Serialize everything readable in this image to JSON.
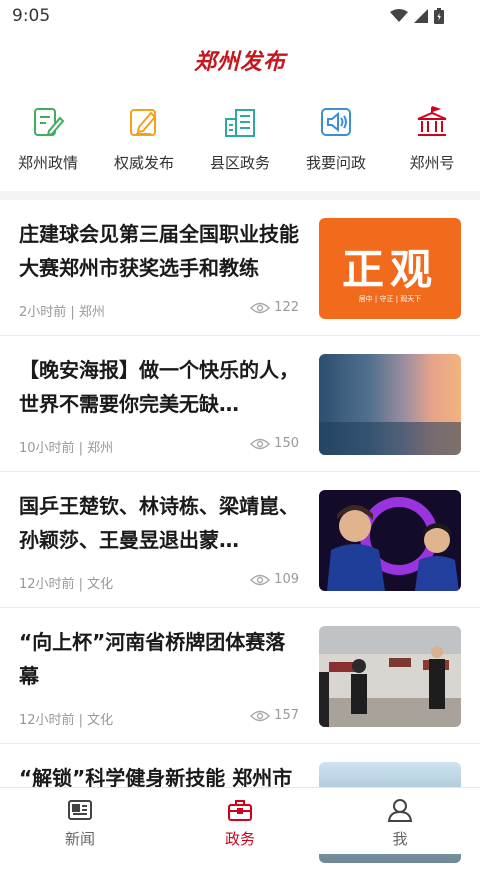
{
  "status_bar": {
    "time": "9:05"
  },
  "header": {
    "logo_text": "郑州发布"
  },
  "quick_nav": [
    {
      "label": "郑州政情",
      "icon": "pen-note-icon",
      "color": "#3fae5f"
    },
    {
      "label": "权威发布",
      "icon": "edit-doc-icon",
      "color": "#f3a21b"
    },
    {
      "label": "县区政务",
      "icon": "buildings-icon",
      "color": "#2fa8a0"
    },
    {
      "label": "我要问政",
      "icon": "speaker-icon",
      "color": "#3a8fd8"
    },
    {
      "label": "郑州号",
      "icon": "hall-icon",
      "color": "#d0021b"
    }
  ],
  "news": [
    {
      "title": "庄建球会见第三届全国职业技能大赛郑州市获奖选手和教练",
      "meta": "2小时前 | 郑州",
      "views": "122",
      "thumb": {
        "type": "banner",
        "text": "正观",
        "sub": "居中 | 守正 | 观天下"
      }
    },
    {
      "title": "【晚安海报】做一个快乐的人，世界不需要你完美无缺…",
      "meta": "10小时前 | 郑州",
      "views": "150",
      "thumb": {
        "type": "sunset"
      }
    },
    {
      "title": "国乒王楚钦、林诗栋、梁靖崑、孙颖莎、王曼昱退出蒙…",
      "meta": "12小时前 | 文化",
      "views": "109",
      "thumb": {
        "type": "pingpong"
      }
    },
    {
      "title": "“向上杯”河南省桥牌团体赛落幕",
      "meta": "12小时前 | 文化",
      "views": "157",
      "thumb": {
        "type": "hall"
      }
    },
    {
      "title": "“解锁”科学健身新技能 郑州市",
      "meta": "",
      "views": "",
      "thumb": {
        "type": "outdoor"
      }
    }
  ],
  "tabs": [
    {
      "label": "新闻",
      "icon": "newspaper-icon",
      "active": false
    },
    {
      "label": "政务",
      "icon": "briefcase-icon",
      "active": true
    },
    {
      "label": "我",
      "icon": "user-icon",
      "active": false
    }
  ],
  "colors": {
    "accent": "#d0021b",
    "thumb_orange": "#f26b1d"
  }
}
